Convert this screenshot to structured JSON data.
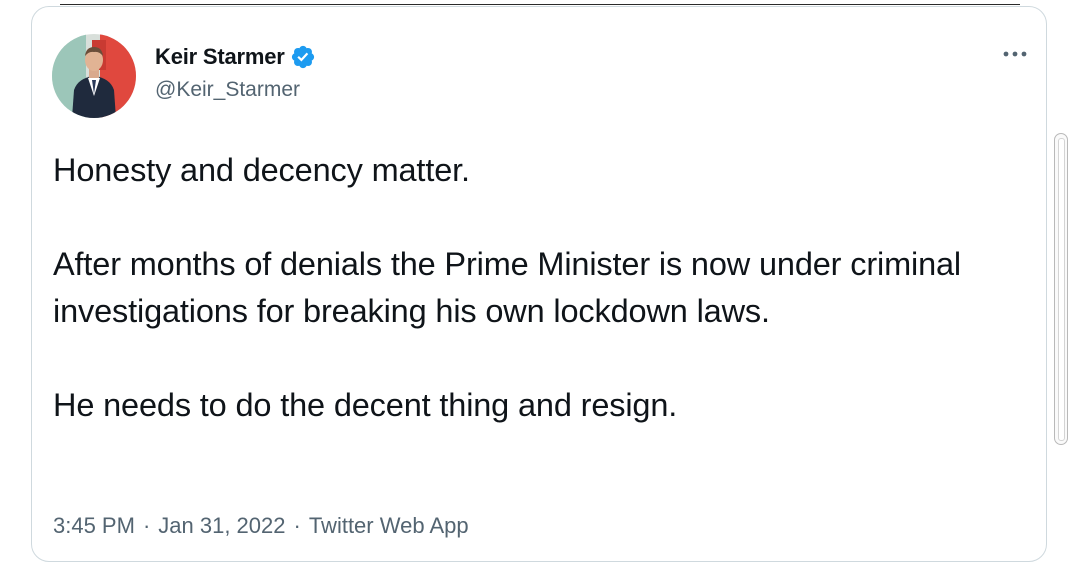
{
  "author": {
    "display_name": "Keir Starmer",
    "handle": "@Keir_Starmer",
    "verified": true
  },
  "tweet": {
    "paragraphs": [
      "Honesty and decency matter.",
      "After months of denials the Prime Minister is now under criminal investigations for breaking his own lockdown laws.",
      "He needs to do the decent thing and resign."
    ],
    "time": "3:45 PM",
    "date": "Jan 31, 2022",
    "source": "Twitter Web App",
    "separator": "·"
  },
  "icons": {
    "verified": "verified-badge-icon",
    "more": "more-options-icon"
  },
  "colors": {
    "verified_blue": "#1d9bf0",
    "text_primary": "#0f1419",
    "text_secondary": "#536471",
    "border": "#cfd9de"
  }
}
